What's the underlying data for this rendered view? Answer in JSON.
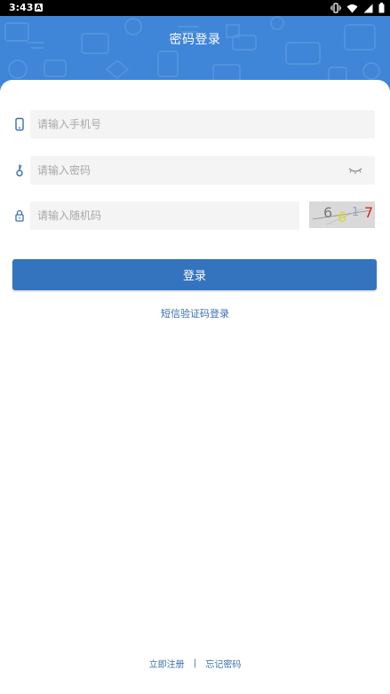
{
  "status_bar": {
    "time": "3:43",
    "app_icon_letter": "A",
    "icons": [
      "vibrate-icon",
      "wifi-icon",
      "signal-icon",
      "battery-icon"
    ]
  },
  "header": {
    "title": "密码登录",
    "background_color": "#3f86d8"
  },
  "form": {
    "phone": {
      "icon": "phone-icon",
      "placeholder": "请输入手机号",
      "value": ""
    },
    "password": {
      "icon": "key-icon",
      "placeholder": "请输入密码",
      "value": "",
      "toggle_icon": "eye-closed-icon"
    },
    "captcha": {
      "icon": "lock-icon",
      "placeholder": "请输入随机码",
      "value": "",
      "image_chars": [
        "6",
        "6",
        "1",
        "7"
      ]
    }
  },
  "login_button": {
    "label": "登录",
    "color": "#3474bf"
  },
  "sms_login_link": "短信验证码登录",
  "footer": {
    "register": "立即注册",
    "separator": "|",
    "forgot_password": "忘记密码"
  },
  "colors": {
    "link": "#3a6fb0",
    "field_background": "#f4f4f4"
  }
}
